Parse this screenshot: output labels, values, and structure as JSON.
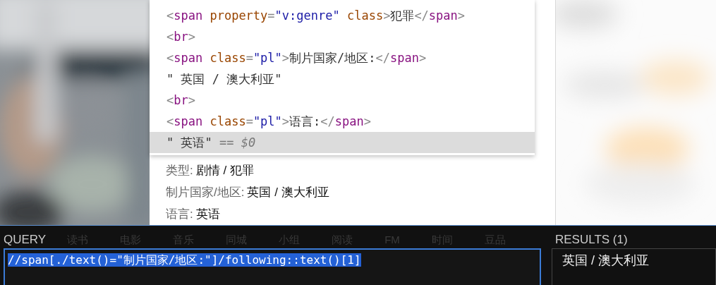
{
  "elements_panel": {
    "lines": [
      {
        "selected": false,
        "tokens": [
          {
            "kind": "punct",
            "text": "<"
          },
          {
            "kind": "tag",
            "text": "span"
          },
          {
            "kind": "attr",
            "text": " property"
          },
          {
            "kind": "punct",
            "text": "="
          },
          {
            "kind": "value",
            "text": "\"v:genre\""
          },
          {
            "kind": "attr",
            "text": " class"
          },
          {
            "kind": "punct",
            "text": ">"
          },
          {
            "kind": "text",
            "text": "犯罪"
          },
          {
            "kind": "punct",
            "text": "</"
          },
          {
            "kind": "tag",
            "text": "span"
          },
          {
            "kind": "punct",
            "text": ">"
          }
        ]
      },
      {
        "selected": false,
        "tokens": [
          {
            "kind": "punct",
            "text": "<"
          },
          {
            "kind": "tag",
            "text": "br"
          },
          {
            "kind": "punct",
            "text": ">"
          }
        ]
      },
      {
        "selected": false,
        "tokens": [
          {
            "kind": "punct",
            "text": "<"
          },
          {
            "kind": "tag",
            "text": "span"
          },
          {
            "kind": "attr",
            "text": " class"
          },
          {
            "kind": "punct",
            "text": "="
          },
          {
            "kind": "value",
            "text": "\"pl\""
          },
          {
            "kind": "punct",
            "text": ">"
          },
          {
            "kind": "text",
            "text": "制片国家/地区:"
          },
          {
            "kind": "punct",
            "text": "</"
          },
          {
            "kind": "tag",
            "text": "span"
          },
          {
            "kind": "punct",
            "text": ">"
          }
        ]
      },
      {
        "selected": false,
        "tokens": [
          {
            "kind": "text",
            "text": "\" 英国 / 澳大利亚\""
          }
        ]
      },
      {
        "selected": false,
        "tokens": [
          {
            "kind": "punct",
            "text": "<"
          },
          {
            "kind": "tag",
            "text": "br"
          },
          {
            "kind": "punct",
            "text": ">"
          }
        ]
      },
      {
        "selected": false,
        "tokens": [
          {
            "kind": "punct",
            "text": "<"
          },
          {
            "kind": "tag",
            "text": "span"
          },
          {
            "kind": "attr",
            "text": " class"
          },
          {
            "kind": "punct",
            "text": "="
          },
          {
            "kind": "value",
            "text": "\"pl\""
          },
          {
            "kind": "punct",
            "text": ">"
          },
          {
            "kind": "text",
            "text": "语言:"
          },
          {
            "kind": "punct",
            "text": "</"
          },
          {
            "kind": "tag",
            "text": "span"
          },
          {
            "kind": "punct",
            "text": ">"
          }
        ]
      },
      {
        "selected": true,
        "tokens": [
          {
            "kind": "text",
            "text": "\" 英语\""
          },
          {
            "kind": "comment",
            "text": " == $0"
          }
        ]
      }
    ]
  },
  "movie_info": [
    {
      "label": "类型:",
      "value": "剧情 / 犯罪"
    },
    {
      "label": "制片国家/地区:",
      "value": "英国 / 澳大利亚"
    },
    {
      "label": "语言:",
      "value": "英语"
    }
  ],
  "background_nav": [
    "读书",
    "电影",
    "音乐",
    "同城",
    "小组",
    "阅读",
    "FM",
    "时间",
    "豆品"
  ],
  "query": {
    "label": "QUERY",
    "value": "//span[./text()=\"制片国家/地区:\"]/following::text()[1]",
    "selected": true
  },
  "results": {
    "label": "RESULTS (1)",
    "items": [
      "英国 / 澳大利亚"
    ]
  }
}
